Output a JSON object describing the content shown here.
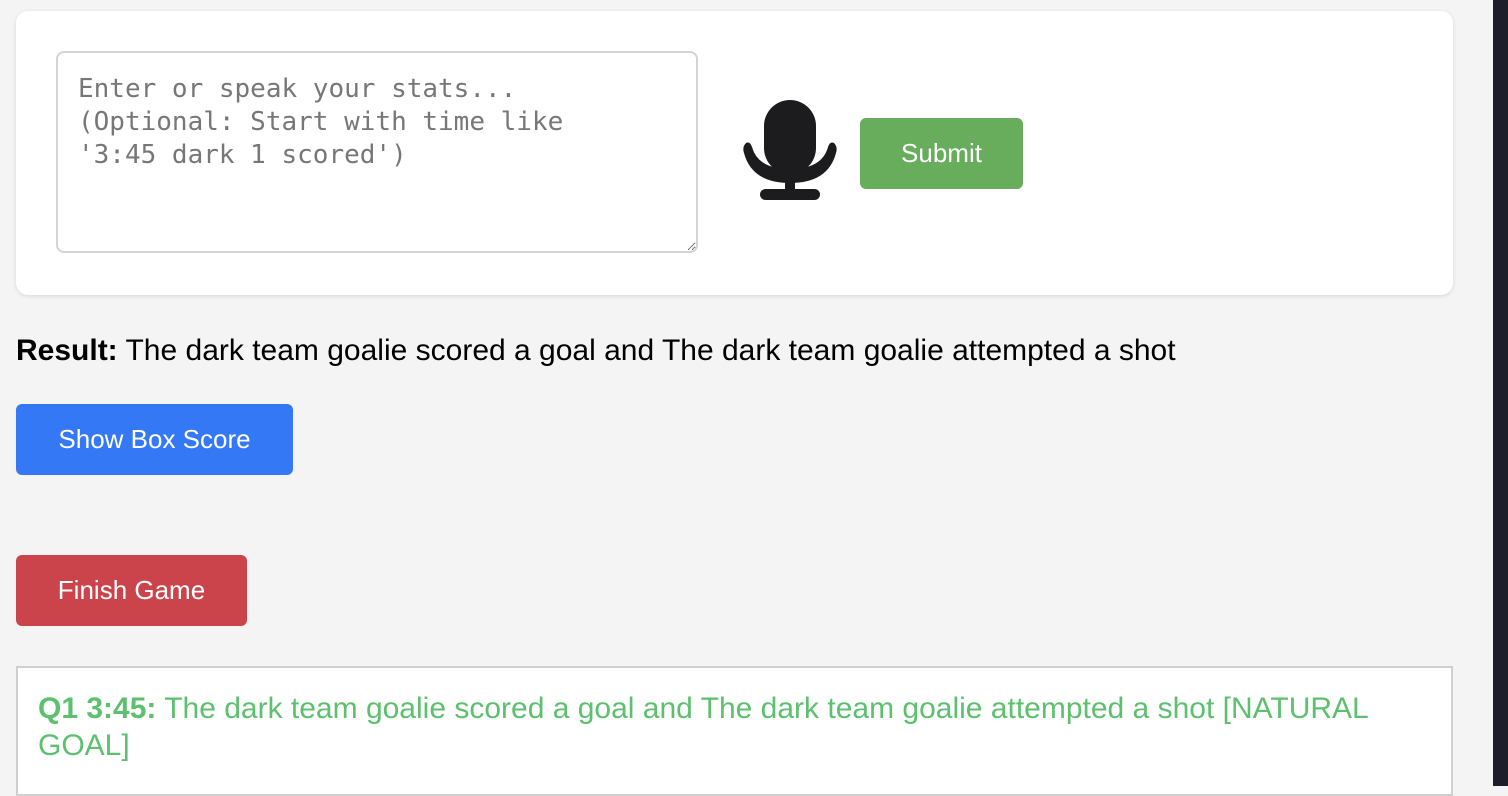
{
  "input": {
    "placeholder": "Enter or speak your stats...\n(Optional: Start with time like\n'3:45 dark 1 scored')",
    "value": ""
  },
  "mic": {
    "icon": "microphone-icon"
  },
  "submit_label": "Submit",
  "result": {
    "label": "Result:",
    "text": "The dark team goalie scored a goal and The dark team goalie attempted a shot"
  },
  "boxscore_label": "Show Box Score",
  "finish_label": "Finish Game",
  "log": {
    "entries": [
      {
        "time": "Q1 3:45:",
        "text": "The dark team goalie scored a goal and The dark team goalie attempted a shot [NATURAL GOAL]"
      }
    ]
  },
  "colors": {
    "submit": "#67ad5b",
    "boxscore": "#3478f6",
    "finish": "#cc444b",
    "log_text": "#5cc06e"
  }
}
